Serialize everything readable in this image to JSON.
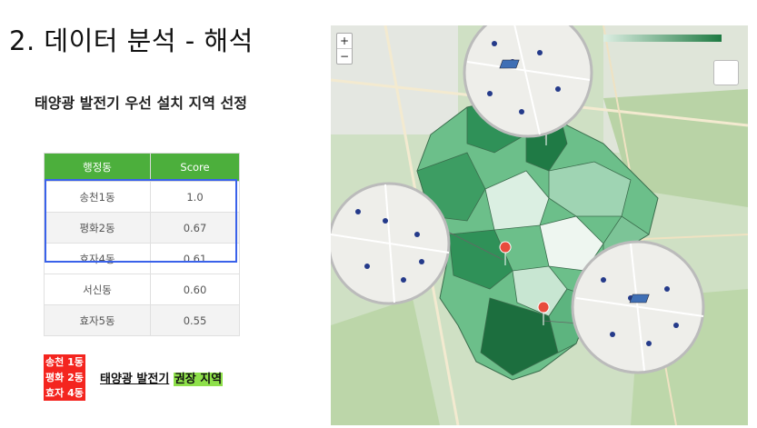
{
  "title": "2. 데이터 분석 - 해석",
  "subtitle": "태양광 발전기 우선 설치 지역 선정",
  "table": {
    "headers": [
      "행정동",
      "Score"
    ],
    "rows": [
      {
        "dong": "송천1동",
        "score": "1.0"
      },
      {
        "dong": "평화2동",
        "score": "0.67"
      },
      {
        "dong": "효자4동",
        "score": "0.61"
      },
      {
        "dong": "서신동",
        "score": "0.60"
      },
      {
        "dong": "효자5동",
        "score": "0.55"
      }
    ]
  },
  "tags": [
    "송천 1동",
    "평화 2동",
    "효자 4동"
  ],
  "recommendation": {
    "prefix": "태양광 발전기",
    "highlight": "권장 지역"
  },
  "map": {
    "zoom_in": "+",
    "zoom_out": "−",
    "legend_ticks": [
      "0.3",
      "0.6",
      "1.0"
    ],
    "colors": {
      "dark": "#1f7a45",
      "mid": "#45a56b",
      "light": "#9fd4b3",
      "pale": "#dbefe2"
    }
  }
}
